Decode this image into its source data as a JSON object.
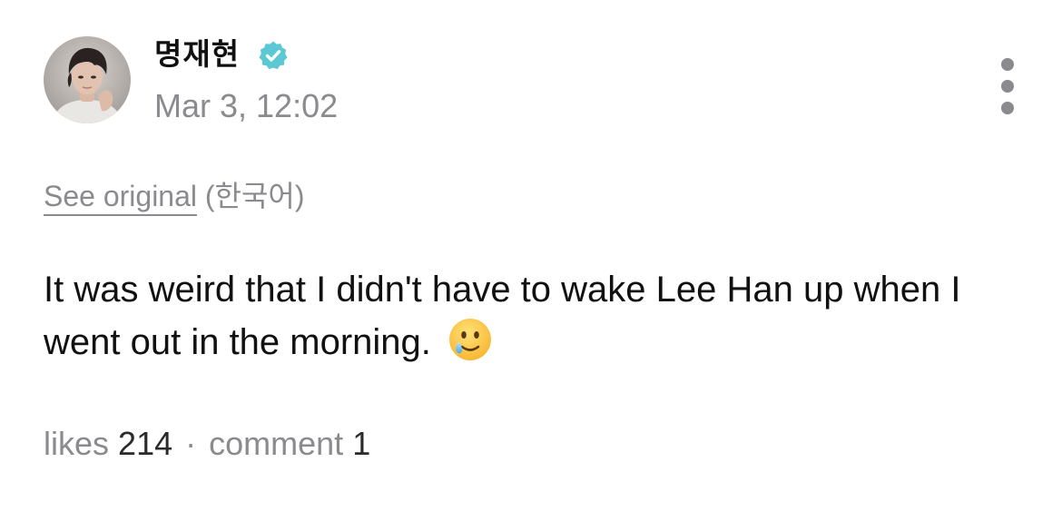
{
  "post": {
    "author": {
      "name": "명재현",
      "verified": true,
      "avatar": "profile-photo"
    },
    "timestamp": "Mar 3, 12:02",
    "menu_icon": "more-vertical-icon",
    "translation": {
      "link_label": "See original",
      "language": "(한국어)"
    },
    "text": "It was weird that I didn't have to wake Lee Han up when I went out in the morning.",
    "emoji": "smiling-face-with-tear-emoji",
    "stats": {
      "likes_label": "likes",
      "likes_count": "214",
      "separator": "·",
      "comments_label": "comment",
      "comments_count": "1"
    }
  },
  "colors": {
    "text": "#111111",
    "secondary": "#8a8a8f",
    "verified_badge": "#5bc8d4",
    "background": "#ffffff"
  }
}
